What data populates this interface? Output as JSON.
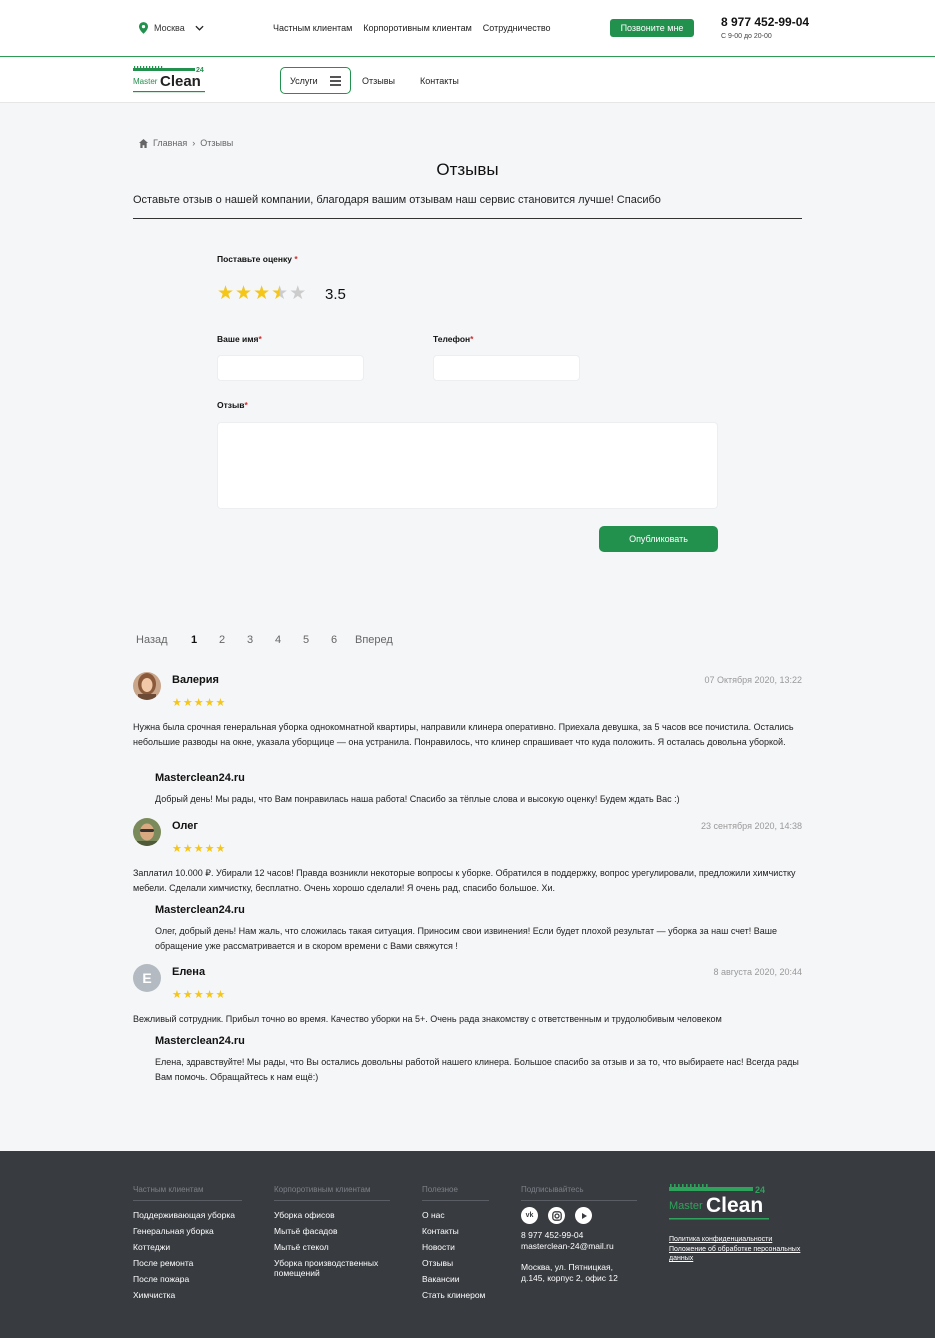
{
  "header": {
    "city": "Москва",
    "nav": [
      "Частным клиентам",
      "Корпоротивным клиентам",
      "Сотрудничество"
    ],
    "call_button": "Позвоните мне",
    "phone": "8 977 452-99-04",
    "hours": "С 9-00 до 20-00"
  },
  "navbar": {
    "logo_small": "Master",
    "logo_big": "Clean",
    "logo_num": "24",
    "services": "Услуги",
    "reviews": "Отзывы",
    "contacts": "Контакты"
  },
  "breadcrumb": {
    "home": "Главная",
    "sep": "›",
    "current": "Отзывы"
  },
  "page": {
    "title": "Отзывы",
    "intro": "Оставьте отзыв о нашей компании, благодаря вашим отзывам наш сервис становится лучше! Спасибо"
  },
  "form": {
    "rating_label": "Поставьте оценку",
    "rating_value": "3.5",
    "rating_fraction": 0.7,
    "name_label": "Ваше имя",
    "phone_label": "Телефон",
    "review_label": "Отзыв",
    "required_mark": "*",
    "name_value": "",
    "phone_value": "",
    "review_value": "",
    "publish": "Опубликовать"
  },
  "pagination": {
    "prev": "Назад",
    "pages": [
      "1",
      "2",
      "3",
      "4",
      "5",
      "6"
    ],
    "active": "1",
    "next": "Вперед"
  },
  "reviews": [
    {
      "name": "Валерия",
      "date": "07 Октября 2020, 13:22",
      "stars": "★★★★★",
      "text": "Нужна была срочная генеральная уборка однокомнатной квартиры, направили клинера оперативно. Приехала девушка, за 5 часов все почистила. Остались небольшие разводы на окне, указала уборщице — она устранила. Понравилось, что клинер спрашивает что куда положить. Я осталась довольна уборкой.",
      "answer_name": "Masterclean24.ru",
      "answer": "Добрый день! Мы рады, что Вам понравилась наша работа! Спасибо за тёплые слова и высокую оценку! Будем ждать Вас :)"
    },
    {
      "name": "Олег",
      "date": "23 сентября 2020, 14:38",
      "stars": "★★★★★",
      "text": "Заплатил 10.000 ₽. Убирали 12 часов! Правда возникли некоторые вопросы к уборке. Обратился в поддержку, вопрос урегулировали, предложили химчистку мебели. Сделали химчистку, бесплатно. Очень хорошо сделали! Я очень рад, спасибо большое. Хи.",
      "answer_name": "Masterclean24.ru",
      "answer": "Олег, добрый день! Нам жаль, что сложилась такая ситуация. Приносим свои извинения! Если будет плохой результат — уборка за наш счет! Ваше обращение уже рассматривается и в скором времени с Вами свяжутся !"
    },
    {
      "name": "Елена",
      "avatar_letter": "Е",
      "date": "8 августа 2020, 20:44",
      "stars": "★★★★★",
      "text": "Вежливый сотрудник. Прибыл точно во время. Качество уборки на 5+. Очень рада знакомству с ответственным и трудолюбивым человеком",
      "answer_name": "Masterclean24.ru",
      "answer": "Елена, здравствуйте! Мы рады, что Вы остались довольны работой нашего клинера. Большое спасибо за отзыв и за то, что выбираете нас! Всегда рады Вам помочь. Обращайтесь к нам ещё:)"
    }
  ],
  "footer": {
    "col1": {
      "title": "Частным клиентам",
      "items": [
        "Поддерживающая уборка",
        "Генеральная уборка",
        "Коттеджи",
        "После ремонта",
        "После пожара",
        "Химчистка"
      ]
    },
    "col2": {
      "title": "Корпоротивным клиентам",
      "items": [
        "Уборка офисов",
        "Мытьё фасадов",
        "Мытьё стекол",
        "Уборка производственных помещений"
      ]
    },
    "col3": {
      "title": "Полезное",
      "items": [
        "О нас",
        "Контакты",
        "Новости",
        "Отзывы",
        "Вакансии",
        "Стать клинером"
      ]
    },
    "col4": {
      "title": "Подписывайтесь",
      "social": [
        "vk-icon",
        "instagram-icon",
        "youtube-icon"
      ],
      "phone": "8 977 452-99-04",
      "email": "masterclean-24@mail.ru",
      "address1": "Москва, ул. Пятницкая,",
      "address2": "д.145, корпус 2, офис 12"
    },
    "privacy": "Политика конфиденциальности",
    "personal_data": "Положение об обработке персональных данных"
  },
  "colors": {
    "accent": "#23914e",
    "star": "#f5c518",
    "footer_bg": "#383b40",
    "page_bg": "#f5f6f8"
  }
}
